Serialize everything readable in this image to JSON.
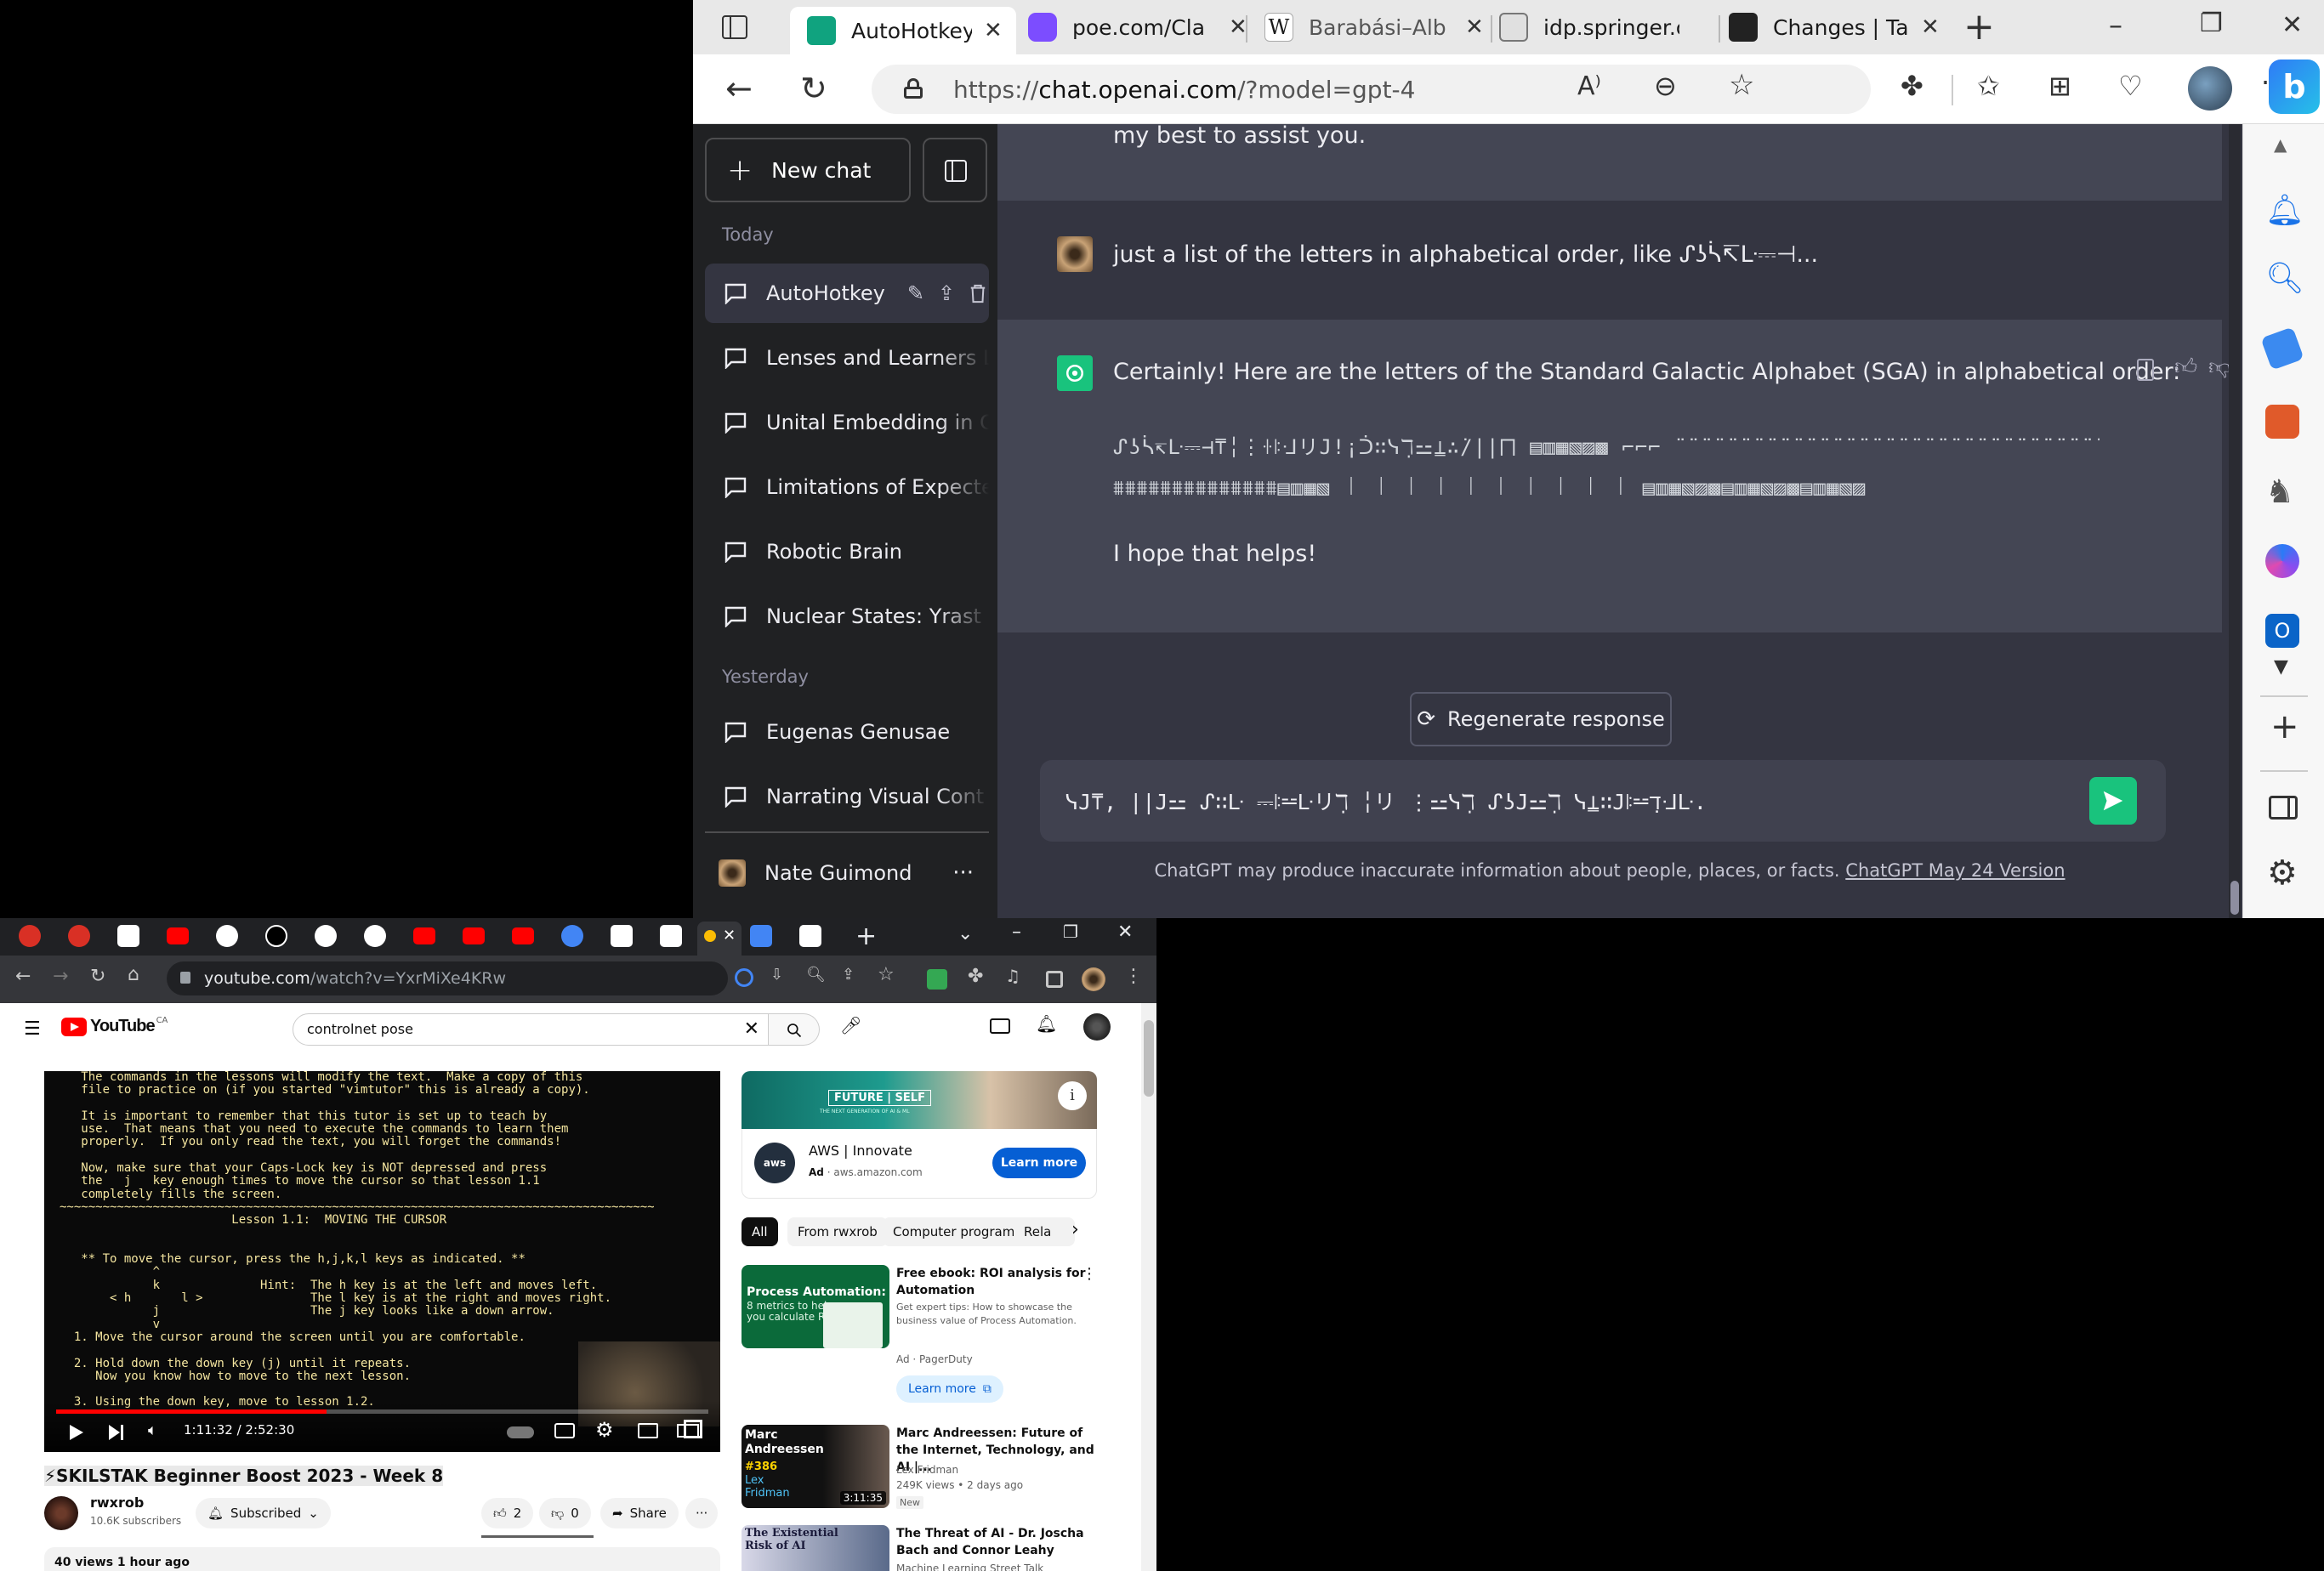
{
  "edge": {
    "tabs": [
      {
        "title": "AutoHotkey I",
        "color": "#10a37f"
      },
      {
        "title": "poe.com/Cla",
        "color": "#7c4dff"
      },
      {
        "title": "Barabási–Alb",
        "color": "#ffffff"
      },
      {
        "title": "idp.springer.c",
        "color": "#e0e0e0"
      },
      {
        "title": "Changes | Tar",
        "color": "#222222"
      }
    ],
    "new_tab": "+",
    "window_controls": [
      "–",
      "❐",
      "✕"
    ],
    "url_scheme": "https://",
    "url_host": "chat.openai.com",
    "url_path": "/?model=gpt-4",
    "more": "···"
  },
  "chatgpt": {
    "new_chat_label": "New chat",
    "section_today": "Today",
    "today_chats": [
      "AutoHotkey",
      "Lenses and Learners L",
      "Unital Embedding in G",
      "Limitations of Expecte",
      "Robotic Brain",
      "Nuclear States: Yrast a"
    ],
    "section_yesterday": "Yesterday",
    "yesterday_chats": [
      "Eugenas Genusae",
      "Narrating Visual Cont"
    ],
    "user_name": "Nate Guimond",
    "user_more": "···",
    "prev_assistant_tail": "my best to assist you.",
    "user_message": "just a list of the letters in alphabetical order, like ᔑʖᓵ↸ᒷ⎓⊣...",
    "assistant_intro": "Certainly! Here are the letters of the Standard Galactic Alphabet (SGA) in alphabetical order:",
    "assistant_glyphs_line1": "ᔑʖᓵ↸ᒷ⎓⊣⍑╎⋮ꖌꖎᒲリ𝙹!¡ᑑ∷ᓭℸ̣⚍⍊∴̇/||⨅ ▤▥▦▧▨▩ ⌐⌐⌐ ¨¨¨¨¨¨¨¨¨¨¨¨¨¨¨¨¨¨¨¨¨¨¨¨¨¨¨¨¨¨¨¨¨¨¨¨¨¨¨¨¨¨¨¨¨¨¨¨¨¨¨",
    "assistant_glyphs_line2": "⩩⩩⩩⩩⩩⩩⩩⩩⩩⩩⩩⩩⩩⩩▤▥▦▧ ꒐ ꒐ ꒐ ꒐ ꒐ ꒐ ꒐ ꒐ ꒐ ꒐ ▤▥▦▧▨▩▤▥▦▧▨▩▤▥▦▧▨",
    "assistant_outro": "I hope that helps!",
    "regenerate_label": "Regenerate response",
    "input_value": "ᓭ𝙹⍑, ||𝙹⚍ ᔑ∷ᒷ ⎓ꖎ⚍ᒷリℸ̣ ╎リ ⋮⚍ᓭℸ̣ ᔑʖ𝙹⚍ℸ̣ ᓭ⍊∷𝙹ꖎ⚍ℸ̣ᒲᒷ.",
    "disclaimer": "ChatGPT may produce inaccurate information about people, places, or facts.",
    "disclaimer_link": "ChatGPT May 24 Version"
  },
  "chrome": {
    "url_host": "youtube.com",
    "url_path": "/watch?v=YxrMiXe4KRw",
    "tab_colors": [
      "#d93025",
      "#d93025",
      "#ffffff",
      "#ff0000",
      "#ffffff",
      "#000000",
      "#ffffff",
      "#ffffff",
      "#ff0000",
      "#ff0000",
      "#ff0000",
      "#4285f4",
      "#ffffff",
      "#ffffff",
      "#fbbc04",
      "#4285f4",
      "#ffffff"
    ]
  },
  "youtube": {
    "logo_text": "YouTube",
    "region": "CA",
    "search_value": "controlnet pose",
    "video_title": "⚡SKILSTAK Beginner Boost 2023 - Week 8",
    "channel_name": "rwxrob",
    "subscribers": "10.6K subscribers",
    "subscribed_label": "Subscribed",
    "likes": "2",
    "dislikes": "0",
    "share_label": "Share",
    "views": "40 views  1 hour ago",
    "timecode": "1:11:32 / 2:52:30",
    "progress_fraction": 0.415,
    "vim_text": "   The commands in the lessons will modify the text.  Make a copy of this\n   file to practice on (if you started \"vimtutor\" this is already a copy).\n\n   It is important to remember that this tutor is set up to teach by\n   use.  That means that you need to execute the commands to learn them\n   properly.  If you only read the text, you will forget the commands!\n\n   Now, make sure that your Caps-Lock key is NOT depressed and press\n   the   j   key enough times to move the cursor so that lesson 1.1\n   completely fills the screen.\n~~~~~~~~~~~~~~~~~~~~~~~~~~~~~~~~~~~~~~~~~~~~~~~~~~~~~~~~~~~~~~~~~~~~~~~~~~~~~~~~~~~\n                        Lesson 1.1:  MOVING THE CURSOR\n\n\n   ** To move the cursor, press the h,j,k,l keys as indicated. **\n             ^\n             k              Hint:  The h key is at the left and moves left.\n       < h       l >               The l key is at the right and moves right.\n             j                     The j key looks like a down arrow.\n             v\n  1. Move the cursor around the screen until you are comfortable.\n\n  2. Hold down the down key (j) until it repeats.\n     Now you know how to move to the next lesson.\n\n  3. Using the down key, move to lesson 1.2.",
    "ad": {
      "banner_brand": "FUTURE | SELF",
      "banner_sub": "THE NEXT GENERATION OF AI & ML",
      "title": "AWS | Innovate",
      "badge": "Ad",
      "domain": "aws.amazon.com",
      "cta": "Learn more"
    },
    "chips": [
      "All",
      "From rwxrob",
      "Computer program",
      "Rela"
    ],
    "recs": [
      {
        "thumb_title": "Process Automation:",
        "thumb_sub": "8 metrics to help you calculate ROI.",
        "title": "Free ebook: ROI analysis for Automation",
        "desc": "Get expert tips: How to showcase the business value of Process Automation.",
        "meta1": "Ad · PagerDuty",
        "cta": "Learn more"
      },
      {
        "thumb_title": "Marc Andreessen",
        "thumb_sub": "#386",
        "thumb_name": "Lex Fridman",
        "duration": "3:11:35",
        "title": "Marc Andreessen: Future of the Internet, Technology, and AI |...",
        "channel": "Lex Fridman",
        "meta1": "249K views  •  2 days ago",
        "badge": "New"
      },
      {
        "thumb_title": "The Existential Risk of AI",
        "title": "The Threat of AI - Dr. Joscha Bach and Connor Leahy",
        "channel": "Machine Learning Street Talk",
        "meta1": ""
      }
    ]
  }
}
